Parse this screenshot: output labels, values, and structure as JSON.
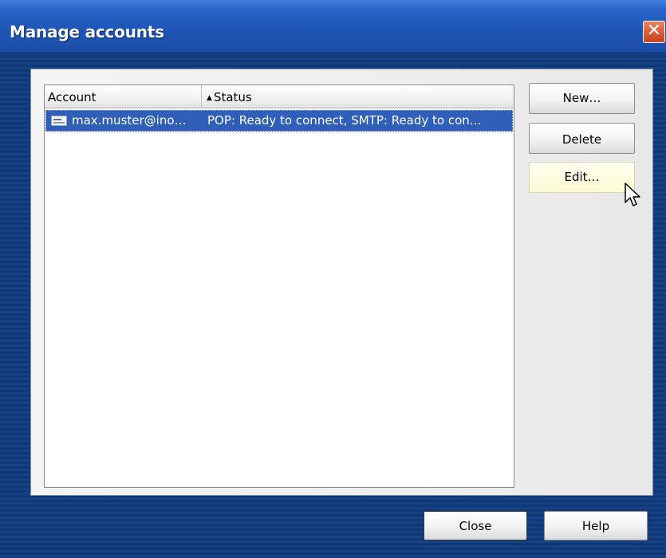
{
  "window": {
    "title": "Manage accounts",
    "close_glyph": "✕"
  },
  "list": {
    "columns": [
      {
        "label": "Account"
      },
      {
        "label": "Status",
        "sort_indicator": "▲"
      }
    ],
    "rows": [
      {
        "icon": "mail-account-icon",
        "account": "max.muster@ino…",
        "status": "POP: Ready to connect, SMTP: Ready to con…",
        "selected": true
      }
    ]
  },
  "buttons": {
    "new": "New…",
    "delete": "Delete",
    "edit": "Edit…",
    "close": "Close",
    "help": "Help"
  },
  "colors": {
    "selection": "#2f5fb8",
    "title_bar": "#1f56b7",
    "window_background": "#0f3a7c",
    "hover_button": "#fbfbd3"
  }
}
